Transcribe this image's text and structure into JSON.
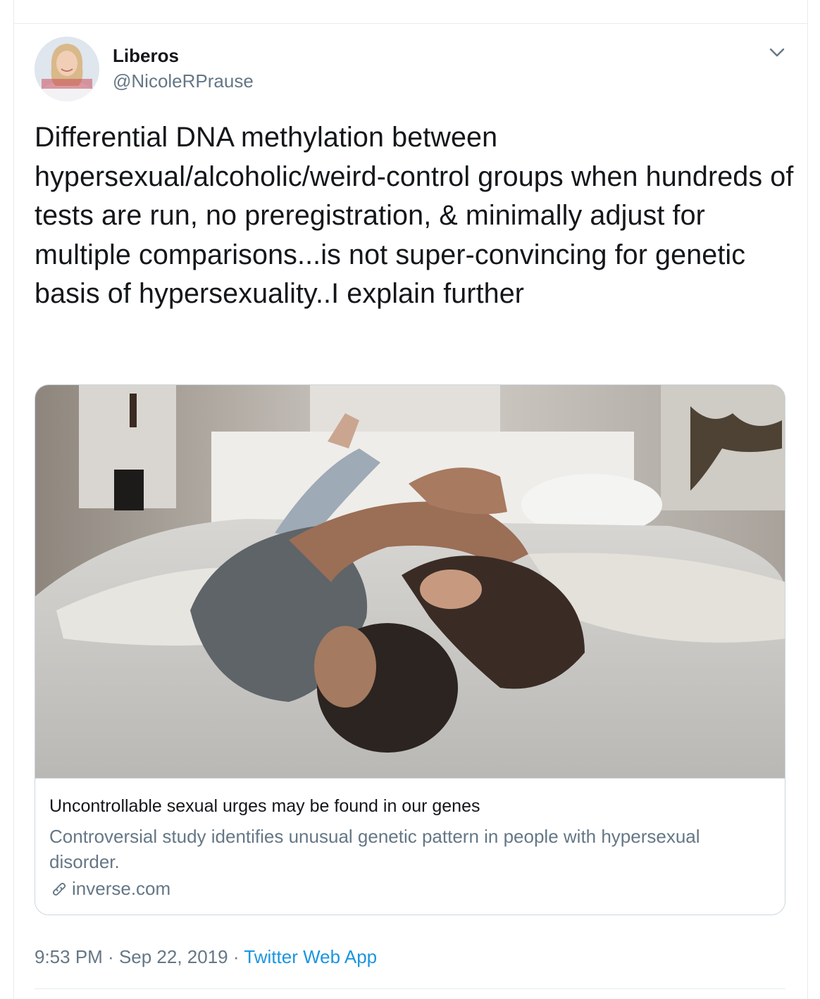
{
  "tweet": {
    "author": {
      "name": "Liberos",
      "handle": "@NicoleRPrause"
    },
    "text": "Differential DNA methylation between hypersexual/alcoholic/weird-control groups when hundreds of tests are run, no preregistration, & minimally adjust for multiple comparisons...is not super-convincing for genetic basis of hypersexuality..I explain further",
    "card": {
      "title": "Uncontrollable sexual urges may be found in our genes",
      "description": "Controversial study identifies unusual genetic pattern in people with hypersexual disorder.",
      "domain": "inverse.com",
      "image_icon": "photo-couple-in-bed"
    },
    "meta": {
      "time": "9:53 PM",
      "separator": " · ",
      "date": "Sep 22, 2019",
      "source": "Twitter Web App"
    }
  },
  "icons": {
    "menu": "chevron-down-icon",
    "link": "link-icon"
  },
  "colors": {
    "link_blue": "#1b95e0",
    "secondary_text": "#657786",
    "border": "#ccd6dd"
  }
}
